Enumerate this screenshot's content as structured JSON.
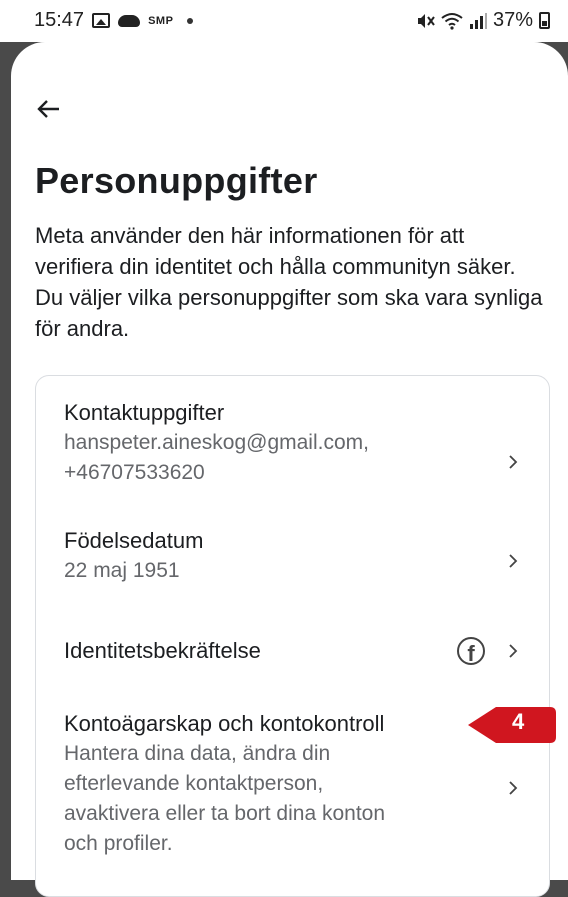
{
  "status_bar": {
    "time": "15:47",
    "carrier_label": "SMP",
    "battery_percent": "37%",
    "icons": [
      "image-icon",
      "cloud-icon",
      "mute-icon",
      "wifi-icon",
      "signal-icon",
      "battery-icon"
    ]
  },
  "header": {
    "back_icon": "arrow-left-icon"
  },
  "page": {
    "title": "Personuppgifter",
    "description": "Meta använder den här informationen för att verifiera din identitet och hålla communityn säker. Du väljer vilka personuppgifter som ska vara synliga för andra."
  },
  "items": [
    {
      "label": "Kontaktuppgifter",
      "value_line1": "hanspeter.aineskog@gmail.com,",
      "value_line2": "+46707533620"
    },
    {
      "label": "Födelsedatum",
      "value_line1": "22 maj 1951"
    },
    {
      "label": "Identitetsbekräftelse",
      "icon": "facebook-icon"
    },
    {
      "label": "Kontoägarskap och kontokontroll",
      "value_line1": "Hantera dina data, ändra din",
      "value_line2": "efterlevande kontaktperson,",
      "value_line3": "avaktivera eller ta bort dina konton",
      "value_line4": "och profiler."
    }
  ],
  "annotation": {
    "badge_number": "4",
    "color": "#d0161f"
  }
}
